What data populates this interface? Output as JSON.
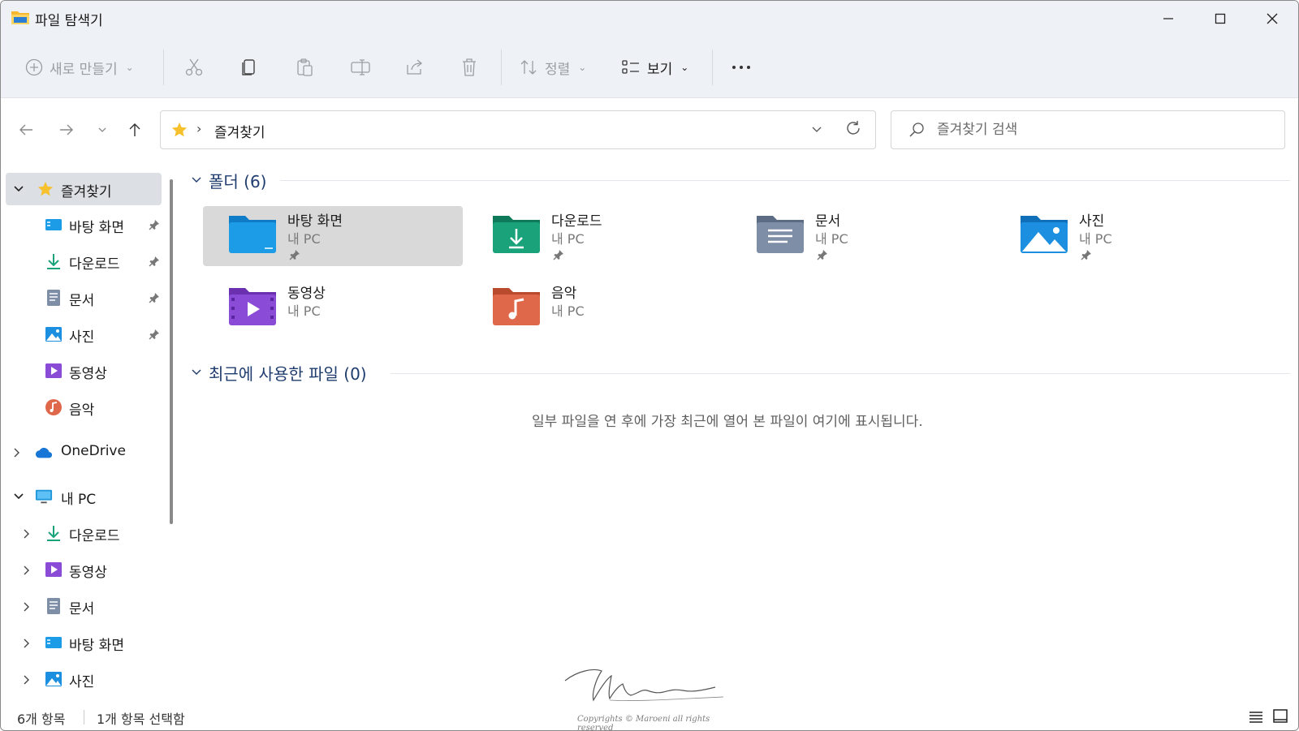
{
  "window": {
    "title": "파일 탐색기"
  },
  "toolbar": {
    "new_label": "새로 만들기",
    "sort_label": "정렬",
    "view_label": "보기"
  },
  "address": {
    "path": "즐겨찾기"
  },
  "search": {
    "placeholder": "즐겨찾기 검색"
  },
  "sidebar": {
    "quick_access": "즐겨찾기",
    "pinned": [
      {
        "label": "바탕 화면",
        "icon": "desktop-icon"
      },
      {
        "label": "다운로드",
        "icon": "download-icon"
      },
      {
        "label": "문서",
        "icon": "document-icon"
      },
      {
        "label": "사진",
        "icon": "pictures-icon"
      }
    ],
    "unpinned": [
      {
        "label": "동영상",
        "icon": "video-icon"
      },
      {
        "label": "음악",
        "icon": "music-icon"
      }
    ],
    "onedrive": "OneDrive",
    "this_pc": "내 PC",
    "pc_items": [
      {
        "label": "다운로드",
        "icon": "download-icon"
      },
      {
        "label": "동영상",
        "icon": "video-icon"
      },
      {
        "label": "문서",
        "icon": "document-icon"
      },
      {
        "label": "바탕 화면",
        "icon": "desktop-icon"
      },
      {
        "label": "사진",
        "icon": "pictures-icon"
      }
    ]
  },
  "content": {
    "folders_header": "폴더 (6)",
    "folders": [
      {
        "name": "바탕 화면",
        "sub": "내 PC",
        "pinned": true,
        "selected": true,
        "color": "#1c9be6"
      },
      {
        "name": "다운로드",
        "sub": "내 PC",
        "pinned": true,
        "color": "#1aa37a"
      },
      {
        "name": "문서",
        "sub": "내 PC",
        "pinned": true,
        "color": "#7d8ea6"
      },
      {
        "name": "사진",
        "sub": "내 PC",
        "pinned": true,
        "color": "#1c8fe0"
      },
      {
        "name": "동영상",
        "sub": "내 PC",
        "pinned": false,
        "color": "#8a4bd6"
      },
      {
        "name": "음악",
        "sub": "내 PC",
        "pinned": false,
        "color": "#e0684a"
      }
    ],
    "recent_header": "최근에 사용한 파일 (0)",
    "recent_empty": "일부 파일을 연 후에 가장 최근에 열어 본 파일이 여기에 표시됩니다."
  },
  "status": {
    "item_count": "6개 항목",
    "selected_count": "1개 항목 선택함"
  },
  "watermark": {
    "signature": "Maroeni",
    "copyright": "Copyrights © Maroeni all rights reserved"
  }
}
